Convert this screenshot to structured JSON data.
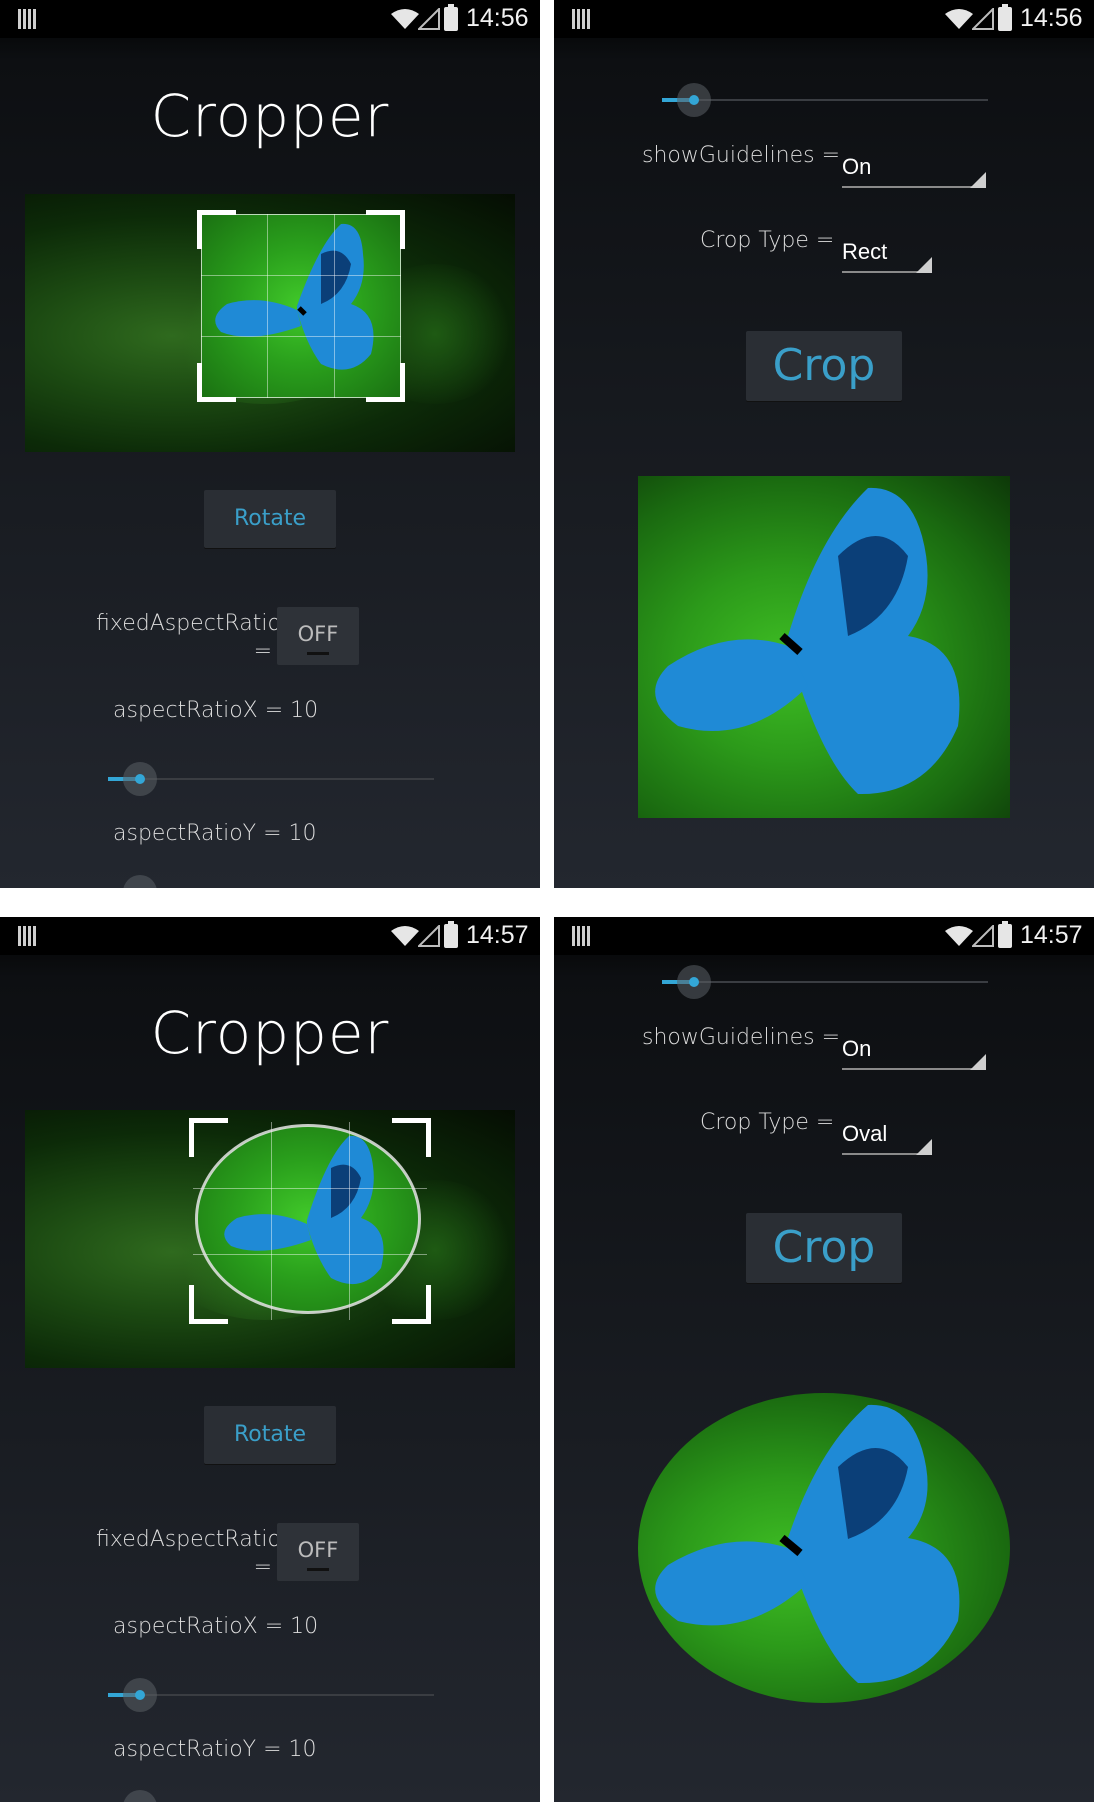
{
  "status": {
    "time_1": "14:56",
    "time_2": "14:56",
    "time_3": "14:57",
    "time_4": "14:57"
  },
  "app": {
    "title": "Cropper"
  },
  "controls": {
    "rotate_label": "Rotate",
    "fixed_aspect_label_line1": "fixedAspectRatio",
    "fixed_aspect_label_line2": "=",
    "fixed_aspect_value": "OFF",
    "aspect_x_label": "aspectRatioX = 10",
    "aspect_y_label": "aspectRatioY = 10",
    "show_guidelines_label": "showGuidelines =",
    "show_guidelines_value": "On",
    "crop_type_label": "Crop Type =",
    "crop_type_value_rect": "Rect",
    "crop_type_value_oval": "Oval",
    "crop_label": "Crop"
  },
  "icons": {
    "notification": "notification-icon",
    "wifi": "wifi-icon",
    "signal": "signal-icon",
    "battery": "battery-charging-icon",
    "butterfly": "butterfly-image"
  },
  "colors": {
    "accent": "#33a6d6",
    "button_text": "#3a9fc9"
  }
}
